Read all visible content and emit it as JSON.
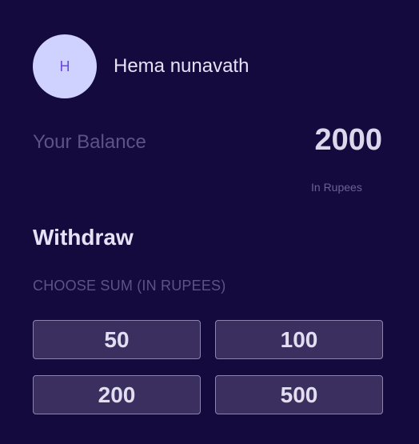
{
  "user": {
    "avatar_initial": "H",
    "name": "Hema nunavath"
  },
  "balance": {
    "label": "Your Balance",
    "amount": "2000",
    "unit": "In Rupees"
  },
  "withdraw": {
    "title": "Withdraw",
    "choose_label": "CHOOSE SUM (IN RUPEES)",
    "options": [
      "50",
      "100",
      "200",
      "500"
    ]
  },
  "colors": {
    "background": "#140a3e",
    "avatar_bg": "#cfd2ff",
    "avatar_text": "#6a4ad6",
    "button_bg": "#3a2f5f",
    "muted_text": "#5d5387"
  }
}
